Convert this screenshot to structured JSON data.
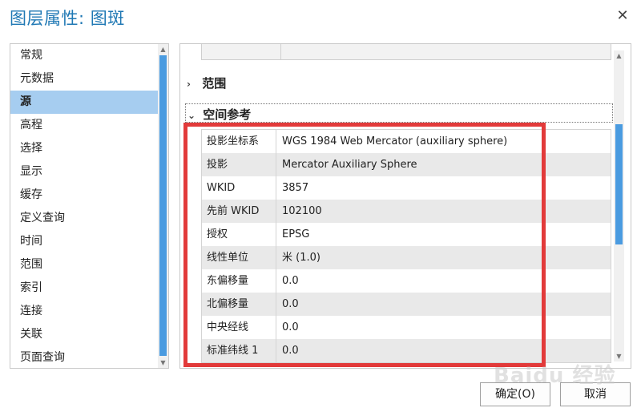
{
  "window": {
    "title": "图层属性: 图斑",
    "close_icon": "✕"
  },
  "nav": {
    "items": [
      {
        "label": "常规"
      },
      {
        "label": "元数据"
      },
      {
        "label": "源",
        "selected": true
      },
      {
        "label": "高程"
      },
      {
        "label": "选择"
      },
      {
        "label": "显示"
      },
      {
        "label": "缓存"
      },
      {
        "label": "定义查询"
      },
      {
        "label": "时间"
      },
      {
        "label": "范围"
      },
      {
        "label": "索引"
      },
      {
        "label": "连接"
      },
      {
        "label": "关联"
      },
      {
        "label": "页面查询"
      }
    ]
  },
  "panel": {
    "range_section": {
      "label": "范围",
      "chevron": "›"
    },
    "sr_section": {
      "label": "空间参考",
      "chevron": "⌄"
    },
    "spatial_reference": [
      {
        "key": "投影坐标系",
        "value": "WGS 1984 Web Mercator (auxiliary sphere)"
      },
      {
        "key": "投影",
        "value": "Mercator Auxiliary Sphere"
      },
      {
        "key": "WKID",
        "value": "3857"
      },
      {
        "key": "先前 WKID",
        "value": "102100"
      },
      {
        "key": "授权",
        "value": "EPSG"
      },
      {
        "key": "线性单位",
        "value": "米 (1.0)"
      },
      {
        "key": "东偏移量",
        "value": "0.0"
      },
      {
        "key": "北偏移量",
        "value": "0.0"
      },
      {
        "key": "中央经线",
        "value": "0.0"
      },
      {
        "key": "标准纬线 1",
        "value": "0.0"
      }
    ]
  },
  "buttons": {
    "ok": "确定(O)",
    "cancel": "取消"
  },
  "watermark": "Baidu 经验",
  "colors": {
    "accent": "#1f78b4",
    "selected_bg": "#a6cdf0",
    "scroll_thumb": "#4a9be0",
    "highlight": "#e23a3a"
  }
}
